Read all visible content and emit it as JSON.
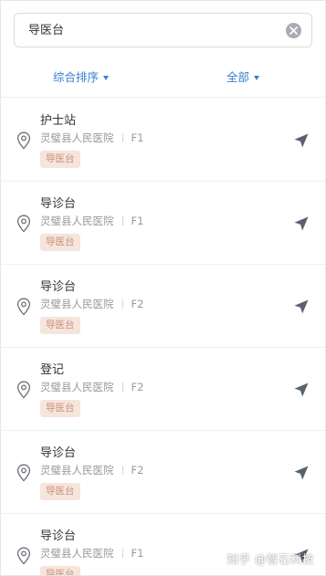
{
  "search": {
    "value": "导医台"
  },
  "filters": {
    "sort_label": "综合排序",
    "scope_label": "全部"
  },
  "locations": [
    {
      "name": "护士站",
      "hospital": "灵璧县人民医院",
      "floor": "F1",
      "tag": "导医台"
    },
    {
      "name": "导诊台",
      "hospital": "灵璧县人民医院",
      "floor": "F1",
      "tag": "导医台"
    },
    {
      "name": "导诊台",
      "hospital": "灵璧县人民医院",
      "floor": "F2",
      "tag": "导医台"
    },
    {
      "name": "登记",
      "hospital": "灵璧县人民医院",
      "floor": "F2",
      "tag": "导医台"
    },
    {
      "name": "导诊台",
      "hospital": "灵璧县人民医院",
      "floor": "F2",
      "tag": "导医台"
    },
    {
      "name": "导诊台",
      "hospital": "灵璧县人民医院",
      "floor": "F1",
      "tag": "导医台"
    }
  ],
  "watermark": {
    "text": "知乎 @智石科技"
  },
  "icons": {
    "pin": "location-pin-icon",
    "navigate": "navigation-arrow-icon",
    "clear": "clear-icon",
    "caret": "caret-down-icon"
  },
  "colors": {
    "accent": "#3d7fd0",
    "tag_bg": "#f6e5dd",
    "tag_text": "#c98f78",
    "nav_icon": "#5a6270"
  }
}
